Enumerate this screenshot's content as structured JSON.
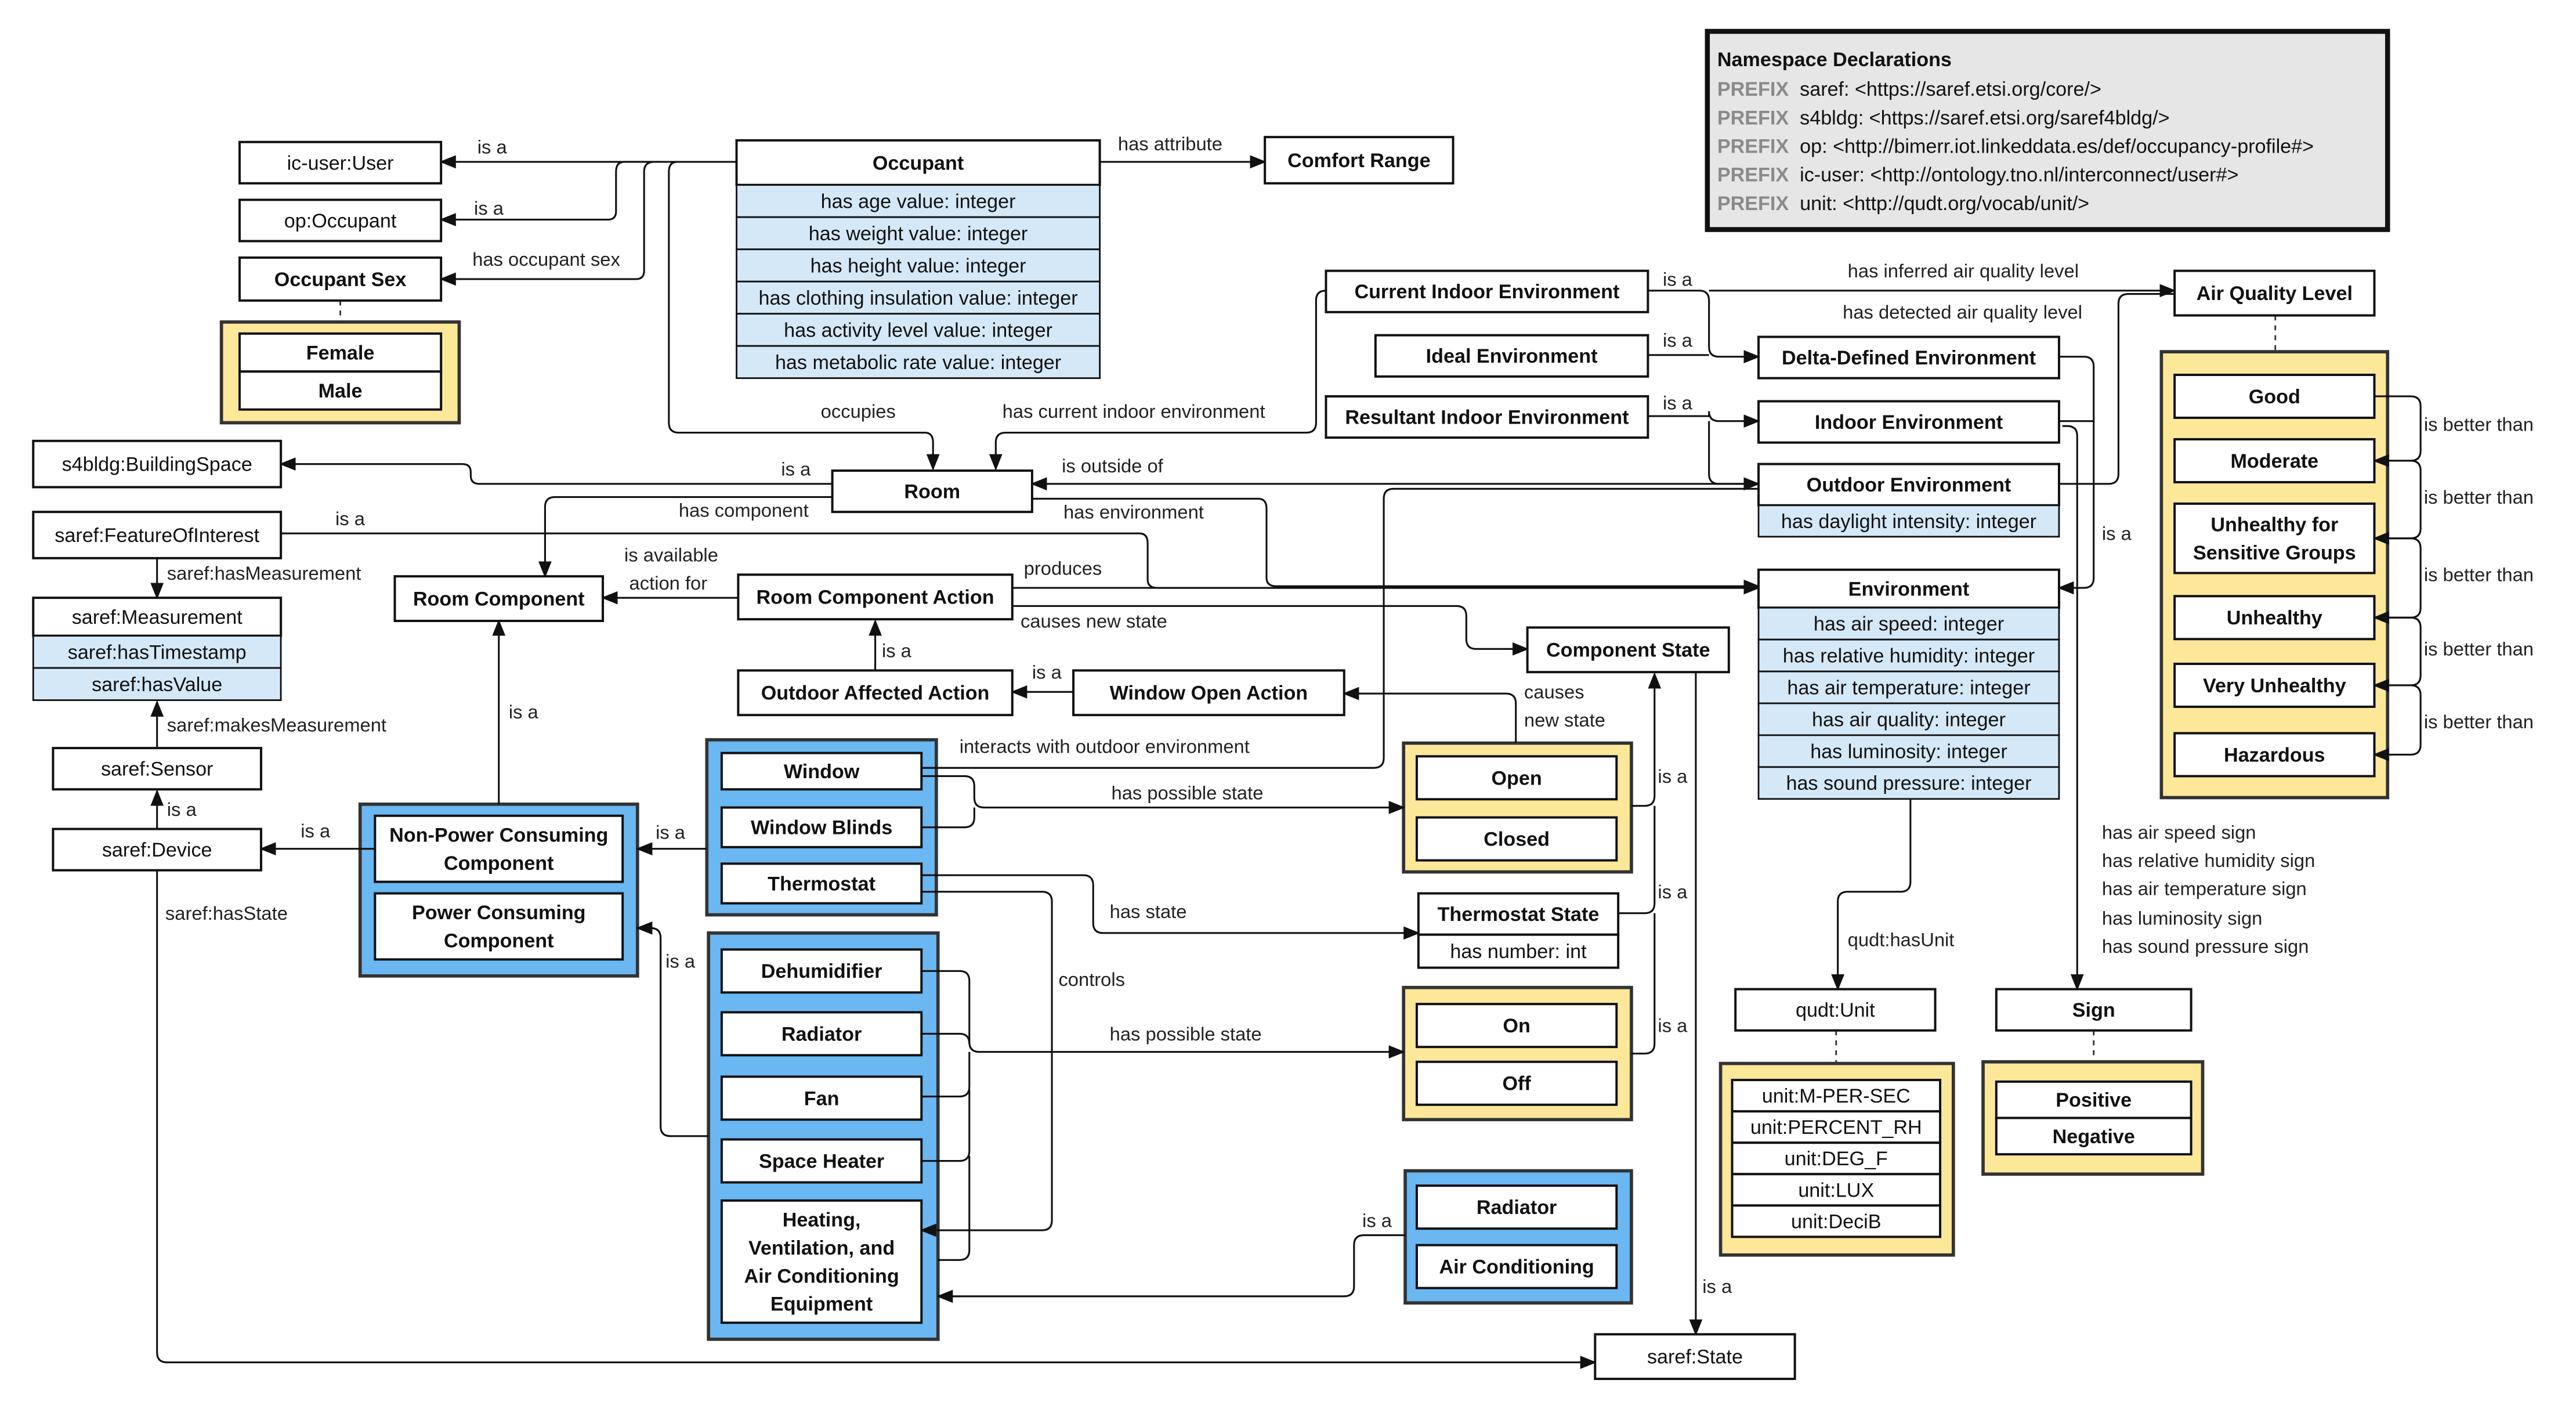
{
  "namespace": {
    "title": "Namespace Declarations",
    "prefixes": [
      {
        "keyword": "PREFIX",
        "value": "saref: <https://saref.etsi.org/core/>"
      },
      {
        "keyword": "PREFIX",
        "value": "s4bldg: <https://saref.etsi.org/saref4bldg/>"
      },
      {
        "keyword": "PREFIX",
        "value": "op: <http://bimerr.iot.linkeddata.es/def/occupancy-profile#>"
      },
      {
        "keyword": "PREFIX",
        "value": "ic-user: <http://ontology.tno.nl/interconnect/user#>"
      },
      {
        "keyword": "PREFIX",
        "value": "unit: <http://qudt.org/vocab/unit/>"
      }
    ]
  },
  "colors": {
    "attribute": "#d5e8f7",
    "enumeration": "#fde89a",
    "group": "#6ab7f2",
    "namespace_bg": "#e6e6e6"
  },
  "nodes": {
    "ic_user": "ic-user:User",
    "op_occupant": "op:Occupant",
    "occupant_sex": "Occupant Sex",
    "female": "Female",
    "male": "Male",
    "occupant": "Occupant",
    "occ_age": "has age value: integer",
    "occ_weight": "has weight value: integer",
    "occ_height": "has height value: integer",
    "occ_clothing": "has clothing insulation value: integer",
    "occ_activity": "has activity level value: integer",
    "occ_metabolic": "has metabolic rate value: integer",
    "comfort_range": "Comfort Range",
    "building_space": "s4bldg:BuildingSpace",
    "feature_of_interest": "saref:FeatureOfInterest",
    "measurement": "saref:Measurement",
    "has_timestamp": "saref:hasTimestamp",
    "has_value": "saref:hasValue",
    "sensor": "saref:Sensor",
    "device": "saref:Device",
    "room": "Room",
    "room_component": "Room Component",
    "room_component_action": "Room Component Action",
    "outdoor_affected_action": "Outdoor Affected Action",
    "window_open_action": "Window Open Action",
    "component_state": "Component State",
    "current_indoor_env": "Current Indoor Environment",
    "ideal_env": "Ideal Environment",
    "resultant_indoor_env": "Resultant Indoor Environment",
    "delta_env": "Delta-Defined Environment",
    "indoor_env": "Indoor Environment",
    "outdoor_env": "Outdoor Environment",
    "outdoor_daylight": "has daylight intensity: integer",
    "environment": "Environment",
    "env_air_speed": "has air speed: integer",
    "env_humidity": "has relative humidity: integer",
    "env_air_temp": "has air temperature: integer",
    "env_air_quality": "has air quality: integer",
    "env_luminosity": "has luminosity: integer",
    "env_sound": "has sound pressure: integer",
    "air_quality_level": "Air Quality Level",
    "aq_good": "Good",
    "aq_moderate": "Moderate",
    "aq_usg": "Unhealthy for Sensitive Groups",
    "aq_unhealthy": "Unhealthy",
    "aq_very_unhealthy": "Very Unhealthy",
    "aq_hazardous": "Hazardous",
    "window": "Window",
    "window_blinds": "Window Blinds",
    "thermostat": "Thermostat",
    "non_power": "Non-Power Consuming Component",
    "power": "Power Consuming Component",
    "dehumidifier": "Dehumidifier",
    "radiator": "Radiator",
    "fan": "Fan",
    "space_heater": "Space Heater",
    "hvac": "Heating, Ventilation, and Air Conditioning Equipment",
    "open": "Open",
    "closed": "Closed",
    "thermostat_state": "Thermostat State",
    "thermostat_number": "has number: int",
    "on": "On",
    "off": "Off",
    "radiator2": "Radiator",
    "air_conditioning": "Air Conditioning",
    "saref_state": "saref:State",
    "qudt_unit": "qudt:Unit",
    "unit_mps": "unit:M-PER-SEC",
    "unit_rh": "unit:PERCENT_RH",
    "unit_degf": "unit:DEG_F",
    "unit_lux": "unit:LUX",
    "unit_decib": "unit:DeciB",
    "sign": "Sign",
    "positive": "Positive",
    "negative": "Negative"
  },
  "edge_labels": [
    "is a",
    "is a",
    "has occupant sex",
    "has attribute",
    "occupies",
    "has current indoor environment",
    "is a",
    "is outside of",
    "has component",
    "has environment",
    "is a",
    "saref:hasMeasurement",
    "is available",
    "action for",
    "produces",
    "causes new state",
    "is a",
    "is a",
    "causes",
    "new state",
    "saref:makesMeasurement",
    "is a",
    "is a",
    "is a",
    "is a",
    "saref:hasState",
    "is a",
    "interacts with outdoor environment",
    "has possible state",
    "has state",
    "controls",
    "has possible state",
    "is a",
    "is a",
    "is a",
    "is a",
    "is a",
    "is a",
    "is a",
    "is a",
    "has inferred air quality level",
    "has detected air quality level",
    "is a",
    "qudt:hasUnit",
    "is better than",
    "is better than",
    "is better than",
    "is better than",
    "is better than",
    "has air speed sign",
    "has relative humidity sign",
    "has air temperature sign",
    "has luminosity sign",
    "has sound pressure sign"
  ]
}
